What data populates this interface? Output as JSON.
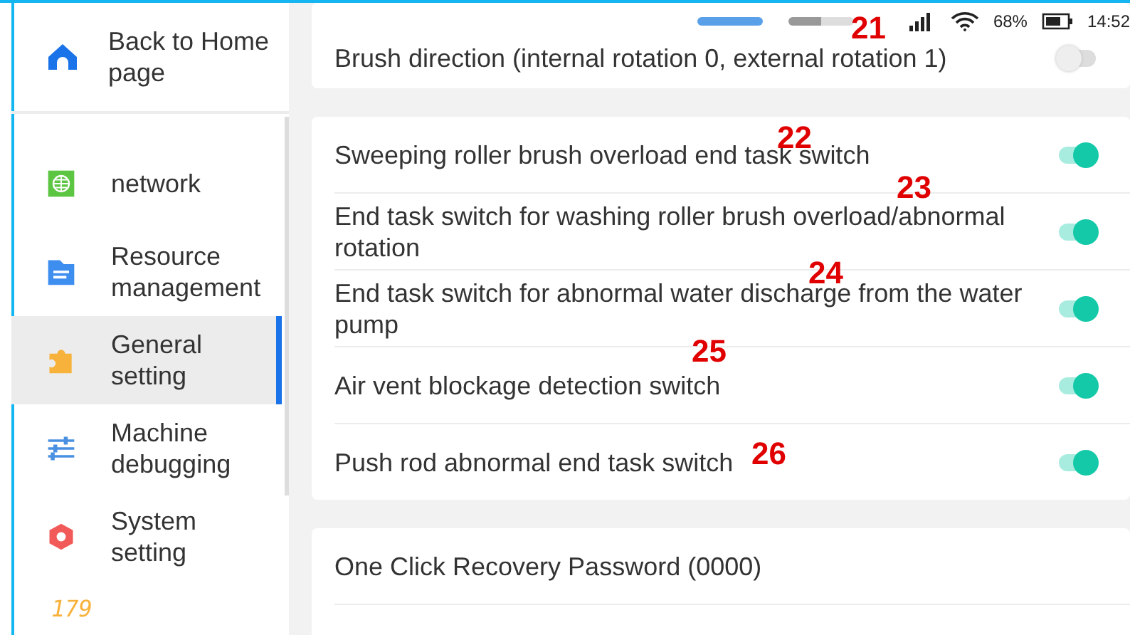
{
  "status_bar": {
    "battery": "68%",
    "time": "14:52"
  },
  "sidebar": {
    "back": {
      "label": "Back to Home page"
    },
    "items": [
      {
        "label": "network",
        "selected": false
      },
      {
        "label": "Resource management",
        "selected": false
      },
      {
        "label": "General setting",
        "selected": true
      },
      {
        "label": "Machine debugging",
        "selected": false
      },
      {
        "label": "System setting",
        "selected": false
      }
    ],
    "footer_digits": "179"
  },
  "groups": [
    {
      "rows": [
        {
          "label": "Brush direction (internal rotation 0, external rotation 1)",
          "on": false
        }
      ]
    },
    {
      "rows": [
        {
          "label": "Sweeping roller brush overload end task switch",
          "on": true
        },
        {
          "label": "End task switch for washing roller brush overload/abnormal rotation",
          "on": true
        },
        {
          "label": "End task switch for abnormal water discharge from the water pump",
          "on": true
        },
        {
          "label": "Air vent blockage detection switch",
          "on": true
        },
        {
          "label": "Push rod abnormal end task switch",
          "on": true
        }
      ]
    },
    {
      "rows": [
        {
          "label": "One Click Recovery Password (0000)"
        }
      ]
    }
  ],
  "annotations": [
    "21",
    "22",
    "23",
    "24",
    "25",
    "26"
  ]
}
